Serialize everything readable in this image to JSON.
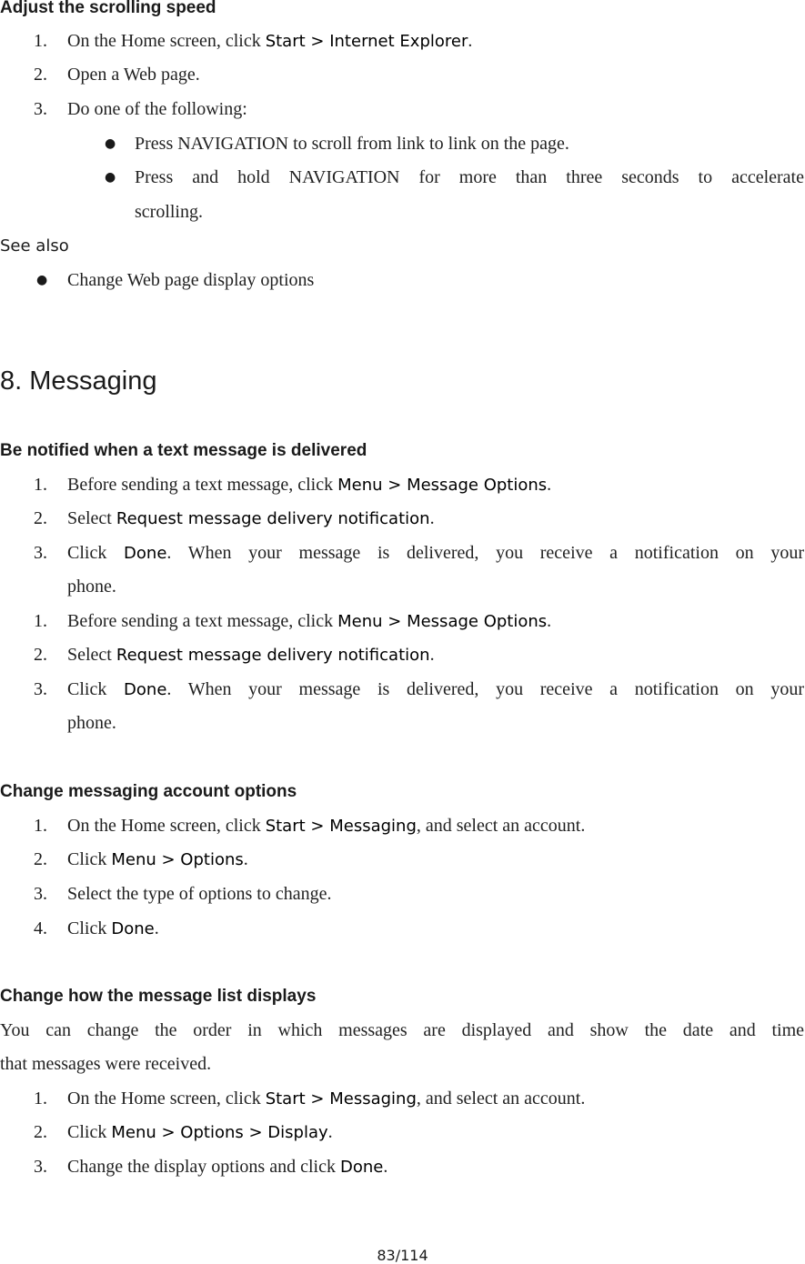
{
  "scroll": {
    "heading": "Adjust the scrolling speed",
    "s1": {
      "n": "1.",
      "a": "On the Home screen, click ",
      "b": "Start",
      "c": " > ",
      "d": "Internet Explorer",
      "e": "."
    },
    "s2": {
      "n": "2.",
      "a": "Open a Web page."
    },
    "s3": {
      "n": "3.",
      "a": "Do one of the following:"
    },
    "bullet1": "Press NAVIGATION to scroll from link to link on the page.",
    "bullet2_line1": "Press and hold NAVIGATION for more than three seconds to accelerate",
    "bullet2_line2": "scrolling.",
    "see_also": "See also",
    "see_also_item": "Change Web page display options"
  },
  "messaging": {
    "title": "8. Messaging",
    "notify": {
      "heading": "Be notified when a text message is delivered",
      "s1": {
        "n": "1.",
        "a": "Before sending a text message, click ",
        "b": "Menu",
        "c": " > ",
        "d": "Message Options",
        "e": "."
      },
      "s2": {
        "n": "2.",
        "a": "Select ",
        "b": "Request message delivery notification",
        "c": "."
      },
      "s3": {
        "n": "3.",
        "a": "Click ",
        "b": "Done",
        "c": ". When your message is delivered, you receive a notification on your",
        "d": "phone."
      },
      "s4": {
        "n": "1.",
        "a": "Before sending a text message, click ",
        "b": "Menu",
        "c": " > ",
        "d": "Message Options",
        "e": "."
      },
      "s5": {
        "n": "2.",
        "a": "Select ",
        "b": "Request message delivery notification",
        "c": "."
      },
      "s6": {
        "n": "3.",
        "a": "Click ",
        "b": "Done",
        "c": ". When your message is delivered, you receive a notification on your",
        "d": "phone."
      }
    },
    "account": {
      "heading": "Change messaging account options",
      "s1": {
        "n": "1.",
        "a": "On the Home screen, click ",
        "b": "Start",
        "c": " > ",
        "d": "Messaging",
        "e": ", and select an account."
      },
      "s2": {
        "n": "2.",
        "a": "Click ",
        "b": "Menu",
        "c": " > ",
        "d": "Options",
        "e": "."
      },
      "s3": {
        "n": "3.",
        "a": "Select the type of options to change."
      },
      "s4": {
        "n": "4.",
        "a": "Click ",
        "b": "Done",
        "c": "."
      }
    },
    "list": {
      "heading": "Change how the message list displays",
      "intro1": "You can change the order in which messages are displayed and show the date and time",
      "intro2": "that messages were received.",
      "s1": {
        "n": "1.",
        "a": "On the Home screen, click ",
        "b": "Start",
        "c": " > ",
        "d": "Messaging",
        "e": ", and select an account."
      },
      "s2": {
        "n": "2.",
        "a": "Click ",
        "b": "Menu",
        "c": " > ",
        "d": "Options",
        "e": " > ",
        "f": "Display",
        "g": "."
      },
      "s3": {
        "n": "3.",
        "a": "Change the display options and click ",
        "b": "Done",
        "c": "."
      }
    }
  },
  "footer": {
    "page": "83/114"
  }
}
